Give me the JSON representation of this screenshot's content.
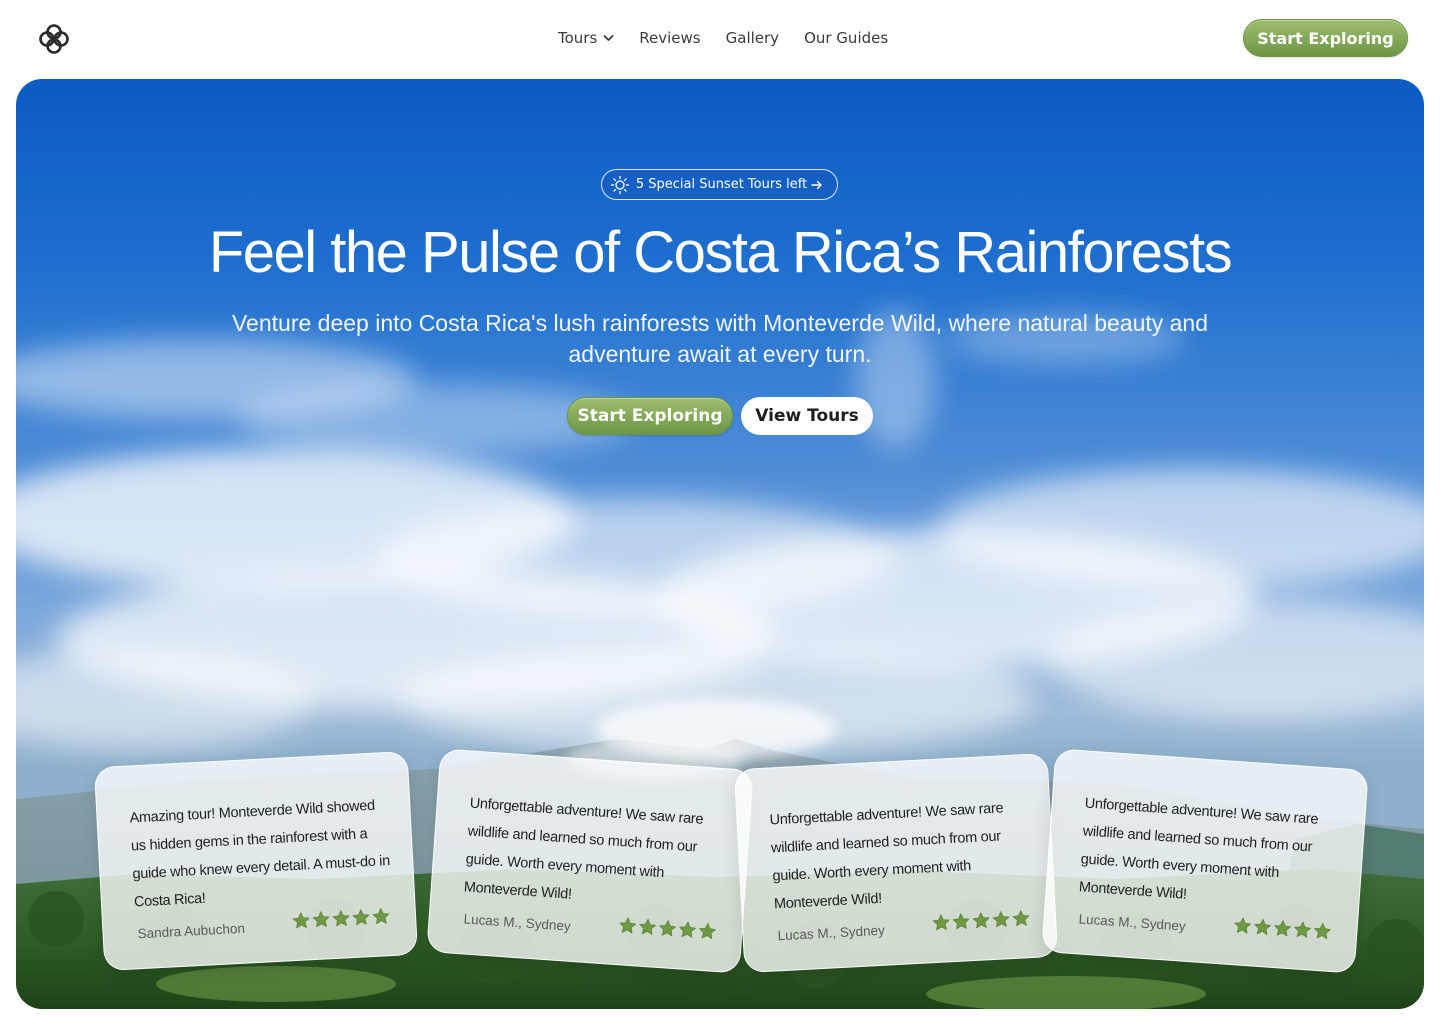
{
  "header": {
    "logo_icon": "clover-logo-icon",
    "nav": [
      {
        "label": "Tours",
        "has_dropdown": true
      },
      {
        "label": "Reviews"
      },
      {
        "label": "Gallery"
      },
      {
        "label": "Our Guides"
      }
    ],
    "cta_label": "Start Exploring"
  },
  "hero": {
    "badge_icon": "sun-icon",
    "badge_label": "5 Special Sunset Tours left",
    "title": "Feel the Pulse of Costa Rica’s Rainforests",
    "subtitle": "Venture deep into Costa Rica's lush rainforests with Monteverde Wild, where natural beauty and adventure await at every turn.",
    "primary_button": "Start Exploring",
    "secondary_button": "View Tours"
  },
  "reviews": [
    {
      "text": "Amazing tour! Monteverde Wild showed us hidden gems in the rainforest with a guide who knew every detail. A must-do in Costa Rica!",
      "author": "Sandra Aubuchon",
      "rating": 5
    },
    {
      "text": "Unforgettable adventure! We saw rare wildlife and learned so much from our guide. Worth every moment with Monteverde Wild!",
      "author": "Lucas M., Sydney",
      "rating": 5
    },
    {
      "text": "Unforgettable adventure! We saw rare wildlife and learned so much from our guide. Worth every moment with Monteverde Wild!",
      "author": "Lucas M., Sydney",
      "rating": 5
    },
    {
      "text": "Unforgettable adventure! We saw rare wildlife and learned so much from our guide. Worth every moment with Monteverde Wild!",
      "author": "Lucas M., Sydney",
      "rating": 5
    }
  ],
  "colors": {
    "accent_green": "#7ba553",
    "sky_blue": "#0b5bc4",
    "star_green": "#6f9a45"
  }
}
